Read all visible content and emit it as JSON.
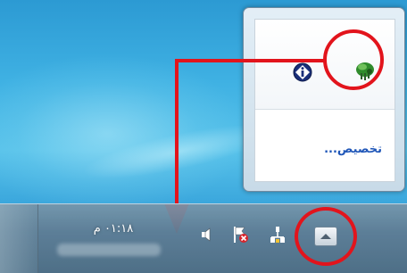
{
  "popup": {
    "customize_link": "تخصيص...",
    "icons": [
      "info-icon",
      "green-network-icon"
    ]
  },
  "taskbar": {
    "clock_time": "٠١:١٨ م",
    "tray_icons": [
      "volume-icon",
      "action-center-flag-icon",
      "network-wired-icon",
      "show-hidden-icons-button"
    ]
  },
  "annotations": {
    "color": "#e2141c"
  }
}
